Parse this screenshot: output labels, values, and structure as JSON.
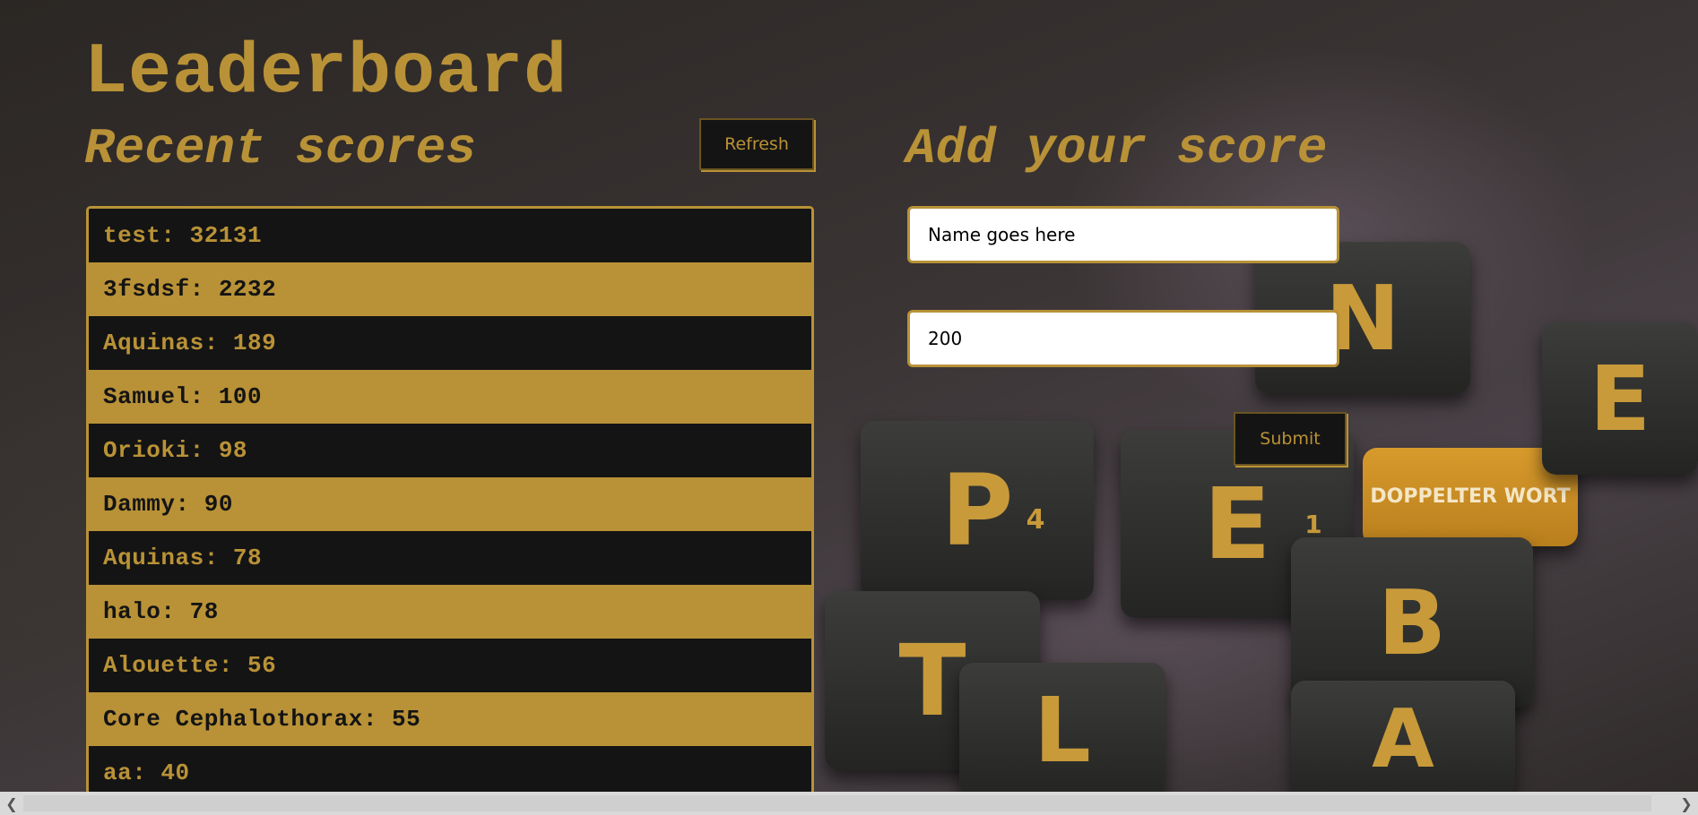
{
  "page": {
    "title": "Leaderboard"
  },
  "recent": {
    "heading": "Recent scores",
    "refresh_label": "Refresh",
    "scores": [
      {
        "text": "test: 32131"
      },
      {
        "text": "3fsdsf: 2232"
      },
      {
        "text": "Aquinas: 189"
      },
      {
        "text": "Samuel: 100"
      },
      {
        "text": "Orioki: 98"
      },
      {
        "text": "Dammy: 90"
      },
      {
        "text": "Aquinas: 78"
      },
      {
        "text": "halo: 78"
      },
      {
        "text": "Alouette: 56"
      },
      {
        "text": "Core Cephalothorax: 55"
      },
      {
        "text": "aa: 40"
      }
    ]
  },
  "add": {
    "heading": "Add your score",
    "name_value": "Name goes here",
    "score_value": "200",
    "submit_label": "Submit"
  },
  "background_tiles": [
    "P",
    "4",
    "E",
    "1",
    "B",
    "T",
    "N",
    "E",
    "A",
    "L"
  ],
  "background_tile_orange": "DOPPELTER WORT",
  "colors": {
    "accent": "#b99237",
    "dark": "#141414"
  },
  "icons": {
    "scroll_left": "chevron-left-icon",
    "scroll_right": "chevron-right-icon"
  }
}
